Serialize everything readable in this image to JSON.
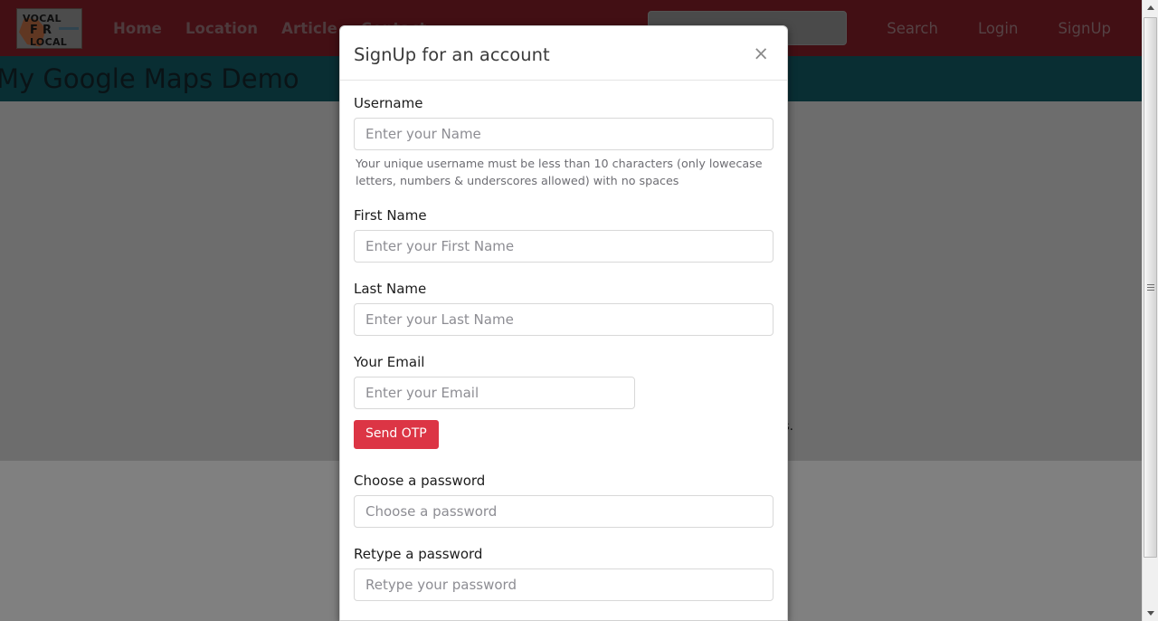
{
  "navbar": {
    "logo": {
      "line1": "VOCAL",
      "line2": "F R",
      "line3": "LOCAL",
      "alt": "vocal-for-local-logo"
    },
    "links": [
      {
        "label": "Home"
      },
      {
        "label": "Location"
      },
      {
        "label": "Article"
      },
      {
        "label": "Contact"
      }
    ],
    "search": {
      "value": "",
      "placeholder": ""
    },
    "actions": [
      {
        "label": "Search"
      },
      {
        "label": "Login"
      },
      {
        "label": "SignUp"
      }
    ],
    "background_color": "#7b1d25",
    "link_color": "#8f6b70"
  },
  "banner": {
    "title": "My Google Maps Demo",
    "background_color": "#11565f",
    "text_color": "#14232a"
  },
  "background": {
    "fragment_text": "s.",
    "map_color": "#c9c9c9",
    "below_color": "#d6d6d6"
  },
  "modal": {
    "title": "SignUp for an account",
    "close_label": "×",
    "fields": {
      "username": {
        "label": "Username",
        "value": "",
        "placeholder": "Enter your Name",
        "help": "Your unique username must be less than 10 characters (only lowecase letters, numbers & underscores allowed) with no spaces"
      },
      "first_name": {
        "label": "First Name",
        "value": "",
        "placeholder": "Enter your First Name"
      },
      "last_name": {
        "label": "Last Name",
        "value": "",
        "placeholder": "Enter your Last Name"
      },
      "email": {
        "label": "Your Email",
        "value": "",
        "placeholder": "Enter your Email"
      },
      "password": {
        "label": "Choose a password",
        "value": "",
        "placeholder": "Choose a password"
      },
      "retype_password": {
        "label": "Retype a password",
        "value": "",
        "placeholder": "Retype your password"
      }
    },
    "send_otp_label": "Send OTP",
    "send_otp_color": "#dc3545"
  },
  "scrollbar": {
    "up_arrow": "scroll-up",
    "down_arrow": "scroll-down",
    "thumb": "scroll-thumb"
  }
}
